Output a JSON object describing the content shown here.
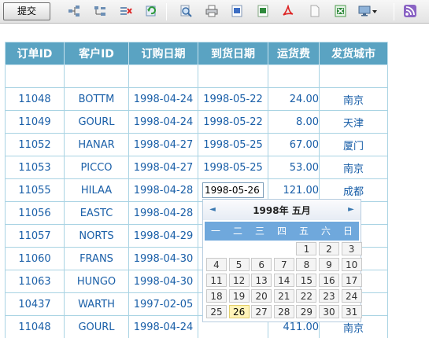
{
  "toolbar": {
    "submit_label": "提交",
    "icons": [
      "tree-add-icon",
      "tree-child-icon",
      "delete-row-icon",
      "refresh-icon",
      "search-icon",
      "print-icon",
      "word-export-icon",
      "excel-export-icon",
      "pdf-export-icon",
      "blank-doc-icon",
      "excel-import-icon",
      "monitor-dropdown-icon",
      "rss-icon"
    ]
  },
  "grid": {
    "columns": [
      "订单ID",
      "客户ID",
      "订购日期",
      "到货日期",
      "运货费",
      "发货城市"
    ],
    "rows": [
      {
        "id": "",
        "customer": "",
        "order_date": "",
        "arrival": "",
        "freight": "",
        "city": ""
      },
      {
        "id": "11048",
        "customer": "BOTTM",
        "order_date": "1998-04-24",
        "arrival": "1998-05-22",
        "freight": "24.00",
        "city": "南京"
      },
      {
        "id": "11049",
        "customer": "GOURL",
        "order_date": "1998-04-24",
        "arrival": "1998-05-22",
        "freight": "8.00",
        "city": "天津"
      },
      {
        "id": "11052",
        "customer": "HANAR",
        "order_date": "1998-04-27",
        "arrival": "1998-05-25",
        "freight": "67.00",
        "city": "厦门"
      },
      {
        "id": "11053",
        "customer": "PICCO",
        "order_date": "1998-04-27",
        "arrival": "1998-05-25",
        "freight": "53.00",
        "city": "南京"
      },
      {
        "id": "11055",
        "customer": "HILAA",
        "order_date": "1998-04-28",
        "arrival": "1998-05-26",
        "freight": "121.00",
        "city": "成都"
      },
      {
        "id": "11056",
        "customer": "EASTC",
        "order_date": "1998-04-28",
        "arrival": "",
        "freight": "",
        "city": ""
      },
      {
        "id": "11057",
        "customer": "NORTS",
        "order_date": "1998-04-29",
        "arrival": "",
        "freight": "",
        "city": ""
      },
      {
        "id": "11060",
        "customer": "FRANS",
        "order_date": "1998-04-30",
        "arrival": "",
        "freight": "",
        "city": ""
      },
      {
        "id": "11063",
        "customer": "HUNGO",
        "order_date": "1998-04-30",
        "arrival": "",
        "freight": "",
        "city": ""
      },
      {
        "id": "10437",
        "customer": "WARTH",
        "order_date": "1997-02-05",
        "arrival": "",
        "freight": "",
        "city": ""
      },
      {
        "id": "11048",
        "customer": "GOURL",
        "order_date": "1998-04-24",
        "arrival": "",
        "freight": "411.00",
        "city": "南京"
      }
    ],
    "edit_value": "1998-05-26"
  },
  "calendar": {
    "title": "1998年 五月",
    "prev": "◄",
    "next": "►",
    "weekdays": [
      "一",
      "二",
      "三",
      "四",
      "五",
      "六",
      "日"
    ],
    "days": [
      [
        "",
        "",
        "",
        "",
        "1",
        "2",
        "3"
      ],
      [
        "4",
        "5",
        "6",
        "7",
        "8",
        "9",
        "10"
      ],
      [
        "11",
        "12",
        "13",
        "14",
        "15",
        "16",
        "17"
      ],
      [
        "18",
        "19",
        "20",
        "21",
        "22",
        "23",
        "24"
      ],
      [
        "25",
        "26",
        "27",
        "28",
        "29",
        "30",
        "31"
      ]
    ],
    "selected": "26"
  }
}
